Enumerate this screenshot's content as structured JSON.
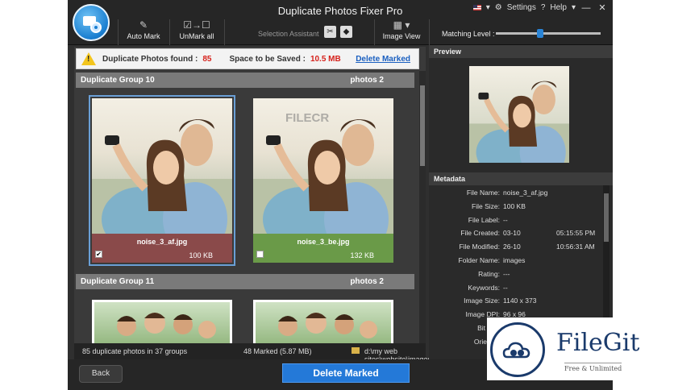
{
  "window": {
    "title": "Duplicate Photos Fixer Pro"
  },
  "topright": {
    "settings": "Settings",
    "help": "Help",
    "help_arrow": "▾",
    "minimize": "—",
    "close": "✕"
  },
  "toolbar": {
    "auto_mark": "Auto Mark",
    "unmark_all": "UnMark all",
    "selection_assistant": "Selection Assistant",
    "image_view": "Image View",
    "matching_level": "Matching Level :",
    "matching_value": 0.42
  },
  "infobar": {
    "found_label": "Duplicate Photos found :",
    "found_count": "85",
    "space_label": "Space to be Saved :",
    "space_value": "10.5 MB",
    "delete_marked": "Delete Marked"
  },
  "groups": [
    {
      "title": "Duplicate Group 10",
      "count": "photos 2"
    },
    {
      "title": "Duplicate Group 11",
      "count": "photos 2"
    }
  ],
  "cards": [
    {
      "filename": "noise_3_af.jpg",
      "size": "100 KB",
      "checked": true,
      "check_glyph": "✔"
    },
    {
      "filename": "noise_3_be.jpg",
      "size": "132 KB",
      "checked": false,
      "check_glyph": ""
    }
  ],
  "watermark": "FILECR",
  "status": {
    "groups_text": "85 duplicate photos in 37 groups",
    "marked_text": "48 Marked (5.87 MB)",
    "path_text": "d:\\my web sites\\website\\images"
  },
  "preview": {
    "header": "Preview"
  },
  "metadata": {
    "header": "Metadata",
    "rows": [
      {
        "k": "File Name:",
        "v": "noise_3_af.jpg",
        "v2": ""
      },
      {
        "k": "File Size:",
        "v": "100 KB",
        "v2": ""
      },
      {
        "k": "File Label:",
        "v": "--",
        "v2": ""
      },
      {
        "k": "File Created:",
        "v": "03-10",
        "v2": "05:15:55 PM"
      },
      {
        "k": "File Modified:",
        "v": "26-10",
        "v2": "10:56:31 AM"
      },
      {
        "k": "Folder Name:",
        "v": "images",
        "v2": ""
      },
      {
        "k": "Rating:",
        "v": "---",
        "v2": ""
      },
      {
        "k": "Keywords:",
        "v": "--",
        "v2": ""
      },
      {
        "k": "Image Size:",
        "v": "1140 x 373",
        "v2": ""
      },
      {
        "k": "Image DPI:",
        "v": "96 x 96",
        "v2": ""
      },
      {
        "k": "Bit Dep",
        "v": "",
        "v2": ""
      },
      {
        "k": "Orientati",
        "v": "",
        "v2": ""
      }
    ]
  },
  "buttons": {
    "back": "Back",
    "delete_marked": "Delete Marked"
  },
  "overlay": {
    "name": "FileGit",
    "tagline": "Free & Unlimited"
  }
}
